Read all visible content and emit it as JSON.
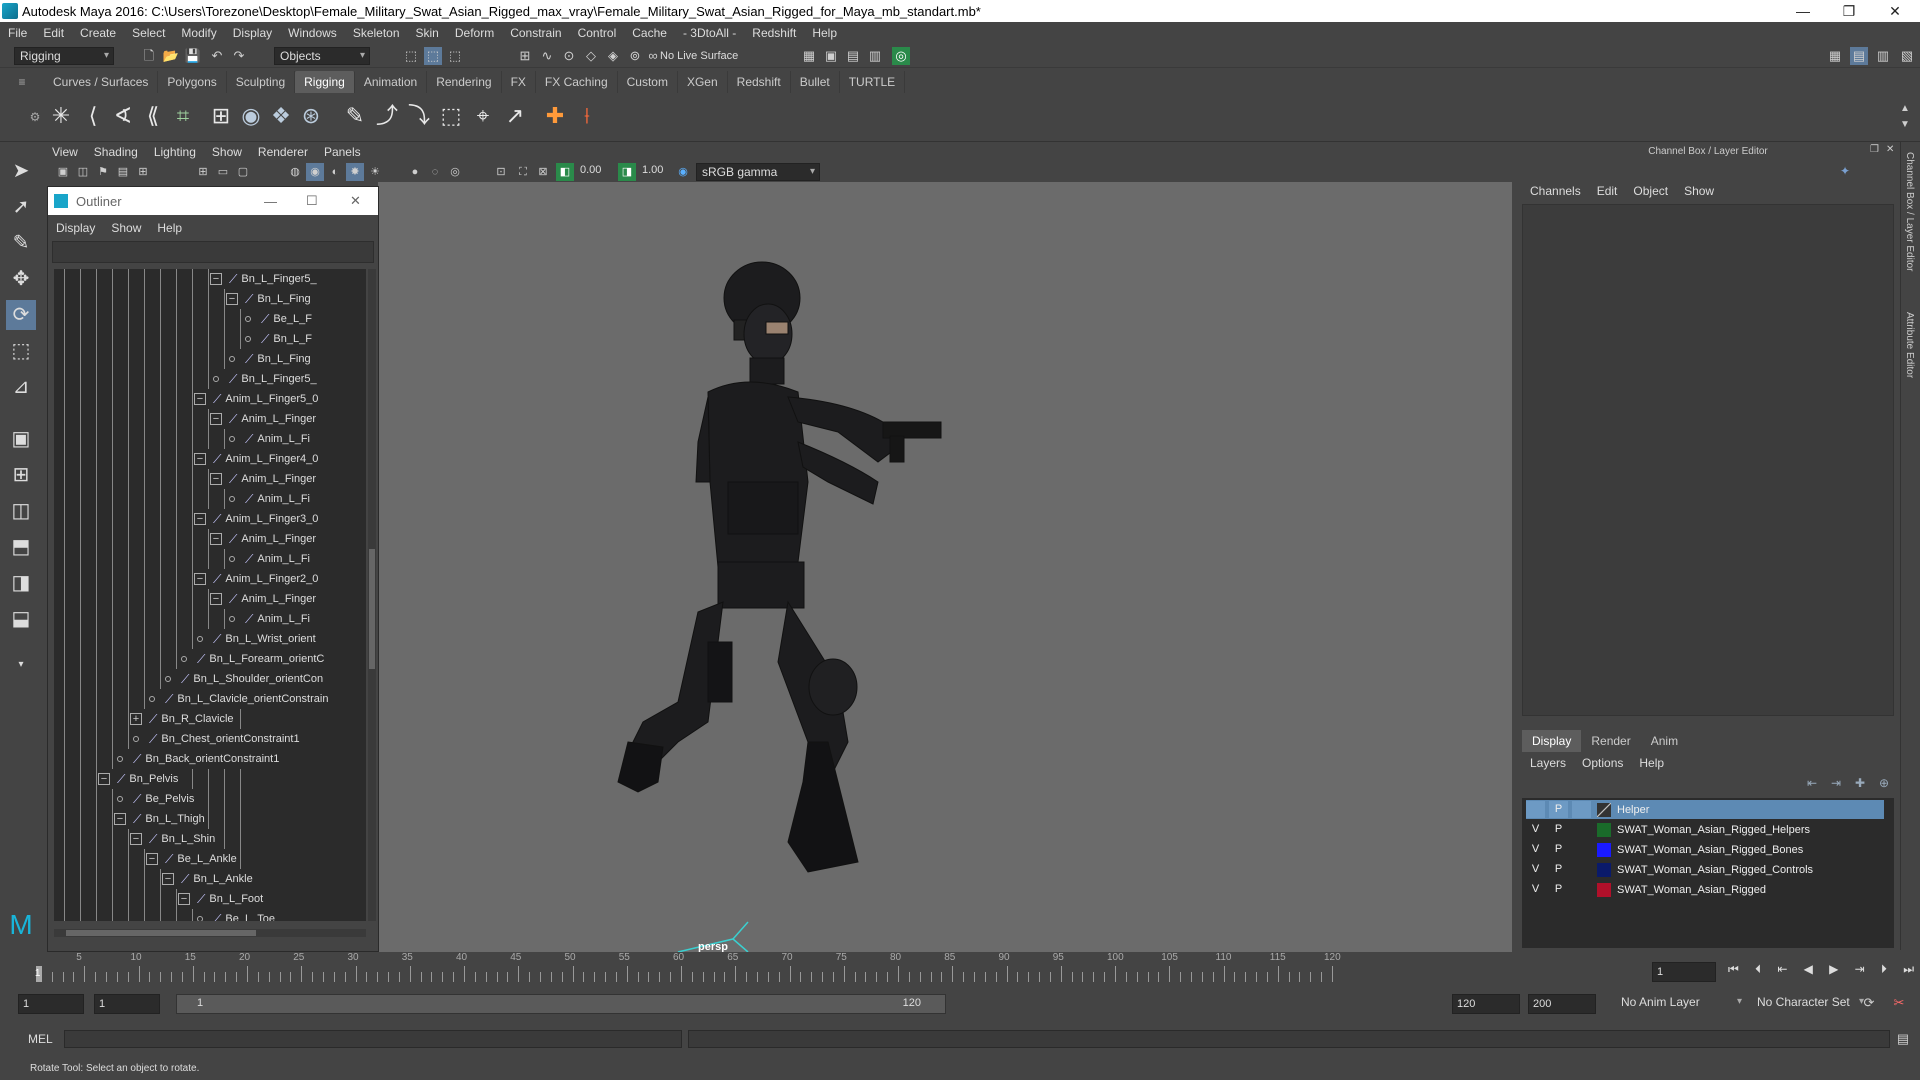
{
  "window": {
    "title": "Autodesk Maya 2016: C:\\Users\\Torezone\\Desktop\\Female_Military_Swat_Asian_Rigged_max_vray\\Female_Military_Swat_Asian_Rigged_for_Maya_mb_standart.mb*"
  },
  "menubar": [
    "File",
    "Edit",
    "Create",
    "Select",
    "Modify",
    "Display",
    "Windows",
    "Skeleton",
    "Skin",
    "Deform",
    "Constrain",
    "Control",
    "Cache",
    "- 3DtoAll -",
    "Redshift",
    "Help"
  ],
  "status": {
    "mode": "Rigging",
    "objects_label": "Objects",
    "live_surface": "No Live Surface"
  },
  "shelf_tabs": [
    "Curves / Surfaces",
    "Polygons",
    "Sculpting",
    "Rigging",
    "Animation",
    "Rendering",
    "FX",
    "FX Caching",
    "Custom",
    "XGen",
    "Redshift",
    "Bullet",
    "TURTLE"
  ],
  "shelf_active": "Rigging",
  "viewport": {
    "menu": [
      "View",
      "Shading",
      "Lighting",
      "Show",
      "Renderer",
      "Panels"
    ],
    "exposure": "0.00",
    "gamma": "1.00",
    "color_space": "sRGB gamma",
    "camera_label": "persp"
  },
  "outliner": {
    "title": "Outliner",
    "menu": [
      "Display",
      "Show",
      "Help"
    ],
    "items": [
      {
        "label": "Bn_L_Finger5_",
        "depth": 10,
        "exp": "−"
      },
      {
        "label": "Bn_L_Fing",
        "depth": 11,
        "exp": "−"
      },
      {
        "label": "Be_L_F",
        "depth": 12,
        "exp": "o"
      },
      {
        "label": "Bn_L_F",
        "depth": 12,
        "exp": "o"
      },
      {
        "label": "Bn_L_Fing",
        "depth": 11,
        "exp": "o"
      },
      {
        "label": "Bn_L_Finger5_",
        "depth": 10,
        "exp": "o"
      },
      {
        "label": "Anim_L_Finger5_0",
        "depth": 9,
        "exp": "−"
      },
      {
        "label": "Anim_L_Finger",
        "depth": 10,
        "exp": "−"
      },
      {
        "label": "Anim_L_Fi",
        "depth": 11,
        "exp": "o"
      },
      {
        "label": "Anim_L_Finger4_0",
        "depth": 9,
        "exp": "−"
      },
      {
        "label": "Anim_L_Finger",
        "depth": 10,
        "exp": "−"
      },
      {
        "label": "Anim_L_Fi",
        "depth": 11,
        "exp": "o"
      },
      {
        "label": "Anim_L_Finger3_0",
        "depth": 9,
        "exp": "−"
      },
      {
        "label": "Anim_L_Finger",
        "depth": 10,
        "exp": "−"
      },
      {
        "label": "Anim_L_Fi",
        "depth": 11,
        "exp": "o"
      },
      {
        "label": "Anim_L_Finger2_0",
        "depth": 9,
        "exp": "−"
      },
      {
        "label": "Anim_L_Finger",
        "depth": 10,
        "exp": "−"
      },
      {
        "label": "Anim_L_Fi",
        "depth": 11,
        "exp": "o"
      },
      {
        "label": "Bn_L_Wrist_orient",
        "depth": 9,
        "exp": "o"
      },
      {
        "label": "Bn_L_Forearm_orientC",
        "depth": 8,
        "exp": "o"
      },
      {
        "label": "Bn_L_Shoulder_orientCon",
        "depth": 7,
        "exp": "o"
      },
      {
        "label": "Bn_L_Clavicle_orientConstrain",
        "depth": 6,
        "exp": "o"
      },
      {
        "label": "Bn_R_Clavicle",
        "depth": 5,
        "exp": "+"
      },
      {
        "label": "Bn_Chest_orientConstraint1",
        "depth": 5,
        "exp": "o"
      },
      {
        "label": "Bn_Back_orientConstraint1",
        "depth": 4,
        "exp": "o"
      },
      {
        "label": "Bn_Pelvis",
        "depth": 3,
        "exp": "−"
      },
      {
        "label": "Be_Pelvis",
        "depth": 4,
        "exp": "o"
      },
      {
        "label": "Bn_L_Thigh",
        "depth": 4,
        "exp": "−"
      },
      {
        "label": "Bn_L_Shin",
        "depth": 5,
        "exp": "−"
      },
      {
        "label": "Be_L_Ankle",
        "depth": 6,
        "exp": "−"
      },
      {
        "label": "Bn_L_Ankle",
        "depth": 7,
        "exp": "−"
      },
      {
        "label": "Bn_L_Foot",
        "depth": 8,
        "exp": "−"
      },
      {
        "label": "Be_L_Toe",
        "depth": 9,
        "exp": "o"
      }
    ]
  },
  "channel_box": {
    "header": "Channel Box / Layer Editor",
    "menu": [
      "Channels",
      "Edit",
      "Object",
      "Show"
    ],
    "side_tabs": [
      "Channel Box / Layer Editor",
      "Attribute Editor"
    ]
  },
  "layer_editor": {
    "tabs": [
      "Display",
      "Render",
      "Anim"
    ],
    "active_tab": "Display",
    "menu": [
      "Layers",
      "Options",
      "Help"
    ],
    "layers": [
      {
        "v": "",
        "p": "P",
        "name": "Helper",
        "color": "#2a2a2a",
        "selected": true
      },
      {
        "v": "V",
        "p": "P",
        "name": "SWAT_Woman_Asian_Rigged_Helpers",
        "color": "#1a6b2a",
        "selected": false
      },
      {
        "v": "V",
        "p": "P",
        "name": "SWAT_Woman_Asian_Rigged_Bones",
        "color": "#1a1aff",
        "selected": false
      },
      {
        "v": "V",
        "p": "P",
        "name": "SWAT_Woman_Asian_Rigged_Controls",
        "color": "#0a1a6a",
        "selected": false
      },
      {
        "v": "V",
        "p": "P",
        "name": "SWAT_Woman_Asian_Rigged",
        "color": "#b0102a",
        "selected": false
      }
    ]
  },
  "timeline": {
    "ticks": [
      "5",
      "10",
      "15",
      "20",
      "25",
      "30",
      "35",
      "40",
      "45",
      "50",
      "55",
      "60",
      "65",
      "70",
      "75",
      "80",
      "85",
      "90",
      "95",
      "100",
      "105",
      "110",
      "115",
      "120"
    ],
    "current_frame": "1",
    "start_marker": "1"
  },
  "range": {
    "start": "1",
    "start2": "1",
    "slider_start": "1",
    "slider_end": "120",
    "end": "120",
    "end2": "200",
    "anim_layer": "No Anim Layer",
    "char_set": "No Character Set"
  },
  "cmd": {
    "lang": "MEL"
  },
  "help": {
    "text": "Rotate Tool: Select an object to rotate."
  }
}
